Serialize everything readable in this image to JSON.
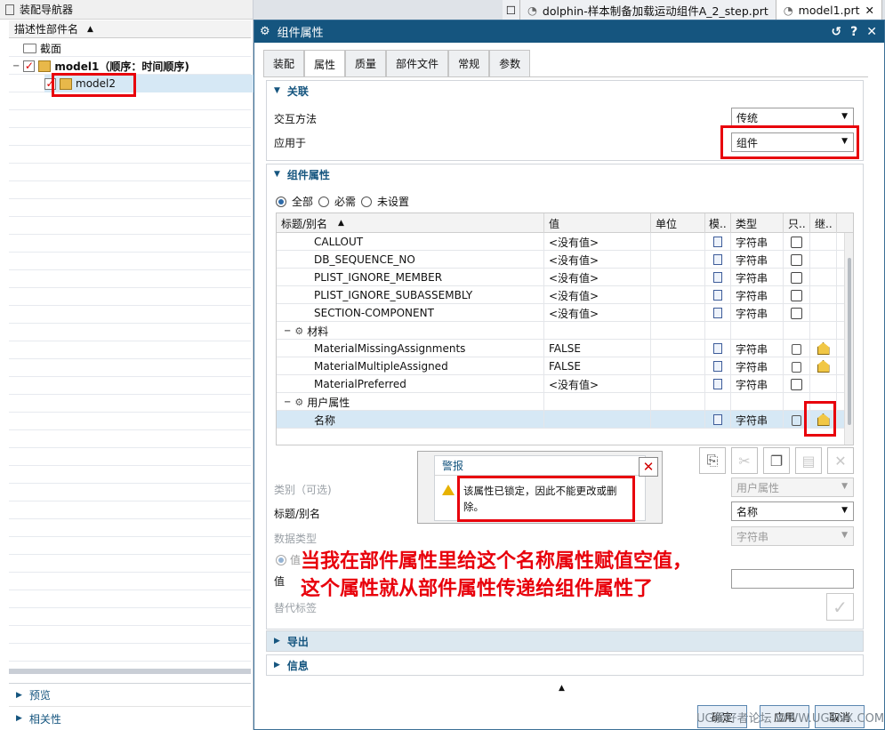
{
  "assembly_navigator": {
    "title": "装配导航器",
    "column_header": "描述性部件名",
    "tree": [
      {
        "label": "截面",
        "level": 1
      },
      {
        "label": "model1（顺序：时间顺序)",
        "level": 0
      },
      {
        "label": "model2",
        "level": 1
      }
    ],
    "bottom_panels": [
      "预览",
      "相关性"
    ]
  },
  "file_tabs": [
    {
      "label": "dolphin-样本制备加载运动组件A_2_step.prt"
    },
    {
      "label": "model1.prt"
    }
  ],
  "dialog": {
    "title": "组件属性",
    "tabs": [
      "装配",
      "属性",
      "质量",
      "部件文件",
      "常规",
      "参数"
    ],
    "active_tab": "属性",
    "association": {
      "header": "关联",
      "interaction_label": "交互方法",
      "interaction_value": "传统",
      "apply_to_label": "应用于",
      "apply_to_value": "组件"
    },
    "component_attributes": {
      "header": "组件属性",
      "filters": [
        "全部",
        "必需",
        "未设置"
      ],
      "filter_selected": "全部",
      "columns": [
        "标题/别名",
        "值",
        "单位",
        "模..",
        "类型",
        "只..",
        "继.."
      ],
      "rows": [
        {
          "title": "CALLOUT",
          "value": "<没有值>",
          "type": "字符串",
          "readonly": "disk",
          "inherit": ""
        },
        {
          "title": "DB_SEQUENCE_NO",
          "value": "<没有值>",
          "type": "字符串",
          "readonly": "disk",
          "inherit": ""
        },
        {
          "title": "PLIST_IGNORE_MEMBER",
          "value": "<没有值>",
          "type": "字符串",
          "readonly": "disk",
          "inherit": ""
        },
        {
          "title": "PLIST_IGNORE_SUBASSEMBLY",
          "value": "<没有值>",
          "type": "字符串",
          "readonly": "disk",
          "inherit": ""
        },
        {
          "title": "SECTION-COMPONENT",
          "value": "<没有值>",
          "type": "字符串",
          "readonly": "disk",
          "inherit": ""
        },
        {
          "title": "材料",
          "group": true
        },
        {
          "title": "MaterialMissingAssignments",
          "value": "FALSE",
          "type": "字符串",
          "readonly": "lock",
          "inherit": "yes"
        },
        {
          "title": "MaterialMultipleAssigned",
          "value": "FALSE",
          "type": "字符串",
          "readonly": "lock",
          "inherit": "yes"
        },
        {
          "title": "MaterialPreferred",
          "value": "<没有值>",
          "type": "字符串",
          "readonly": "disk",
          "inherit": ""
        },
        {
          "title": "用户属性",
          "group": true
        },
        {
          "title": "名称",
          "value": "",
          "type": "字符串",
          "readonly": "lock",
          "inherit": "yes",
          "selected": true
        }
      ]
    },
    "form": {
      "category_label": "类别（可选)",
      "category_value": "用户属性",
      "title_label": "标题/别名",
      "title_value": "名称",
      "datatype_label": "数据类型",
      "datatype_value": "字符串",
      "value_radio": "值",
      "value_label": "值",
      "substitute_label": "替代标签"
    },
    "alert": {
      "title": "警报",
      "message": "该属性已锁定，因此不能更改或删除。"
    },
    "annotation": [
      "当我在部件属性里给这个名称属性赋值空值，",
      "这个属性就从部件属性传递给组件属性了"
    ],
    "collapsed_sections": [
      "导出",
      "信息"
    ],
    "buttons": {
      "ok": "确定",
      "apply": "应用",
      "cancel": "取消"
    },
    "watermark": "UG爱好者论坛 WWW.UGSNX.COM"
  },
  "colors": {
    "accent": "#15557f",
    "highlight": "#e8000b",
    "selected_row": "#d6e8f5"
  }
}
